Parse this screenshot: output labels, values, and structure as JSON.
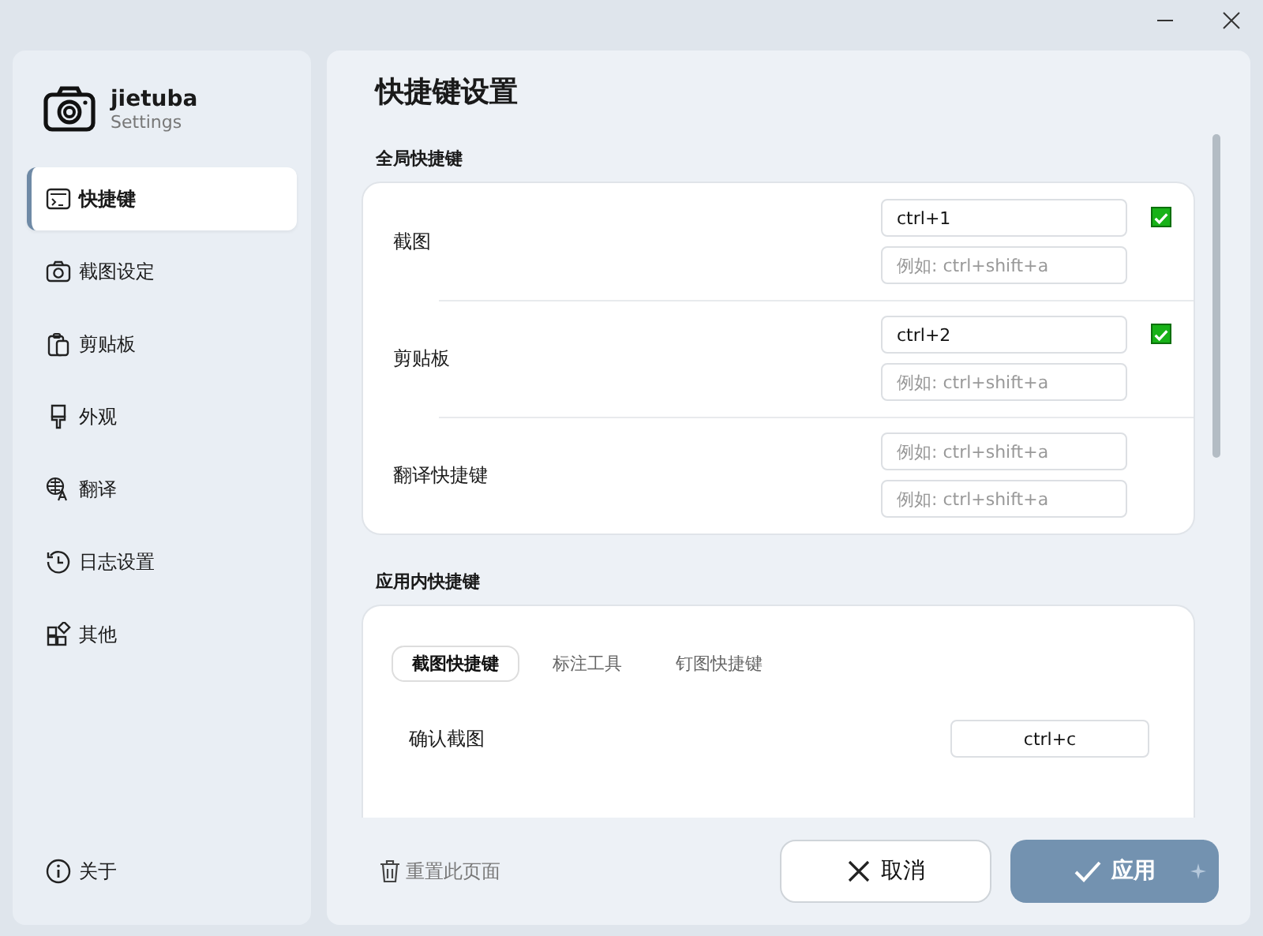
{
  "sidebar": {
    "app_name": "jietuba",
    "app_subtitle": "Settings",
    "items": [
      {
        "label": "快捷键",
        "kind": "shortcut",
        "selected": true
      },
      {
        "label": "截图设定",
        "kind": "camera",
        "selected": false
      },
      {
        "label": "剪贴板",
        "kind": "clipboard",
        "selected": false
      },
      {
        "label": "外观",
        "kind": "brush",
        "selected": false
      },
      {
        "label": "翻译",
        "kind": "translate",
        "selected": false
      },
      {
        "label": "日志设置",
        "kind": "history",
        "selected": false
      },
      {
        "label": "其他",
        "kind": "other",
        "selected": false
      }
    ],
    "about": "关于"
  },
  "page_title": "快捷键设置",
  "global_shortcuts": {
    "heading": "全局快捷键",
    "rows": [
      {
        "label": "截图",
        "checked": true,
        "fields": [
          {
            "value": "ctrl+1"
          },
          {
            "placeholder": "例如: ctrl+shift+a"
          }
        ]
      },
      {
        "label": "剪贴板",
        "checked": true,
        "fields": [
          {
            "value": "ctrl+2"
          },
          {
            "placeholder": "例如: ctrl+shift+a"
          }
        ]
      },
      {
        "label": "翻译快捷键",
        "fields": [
          {
            "placeholder": "例如: ctrl+shift+a"
          },
          {
            "placeholder": "例如: ctrl+shift+a"
          }
        ]
      }
    ]
  },
  "in_app_shortcuts": {
    "heading": "应用内快捷键",
    "tabs": [
      {
        "label": "截图快捷键",
        "selected": true
      },
      {
        "label": "标注工具",
        "selected": false
      },
      {
        "label": "钉图快捷键",
        "selected": false
      }
    ],
    "rows": [
      {
        "label": "确认截图",
        "value": "ctrl+c"
      }
    ]
  },
  "footer": {
    "reset": "重置此页面",
    "cancel": "取消",
    "apply": "应用"
  }
}
